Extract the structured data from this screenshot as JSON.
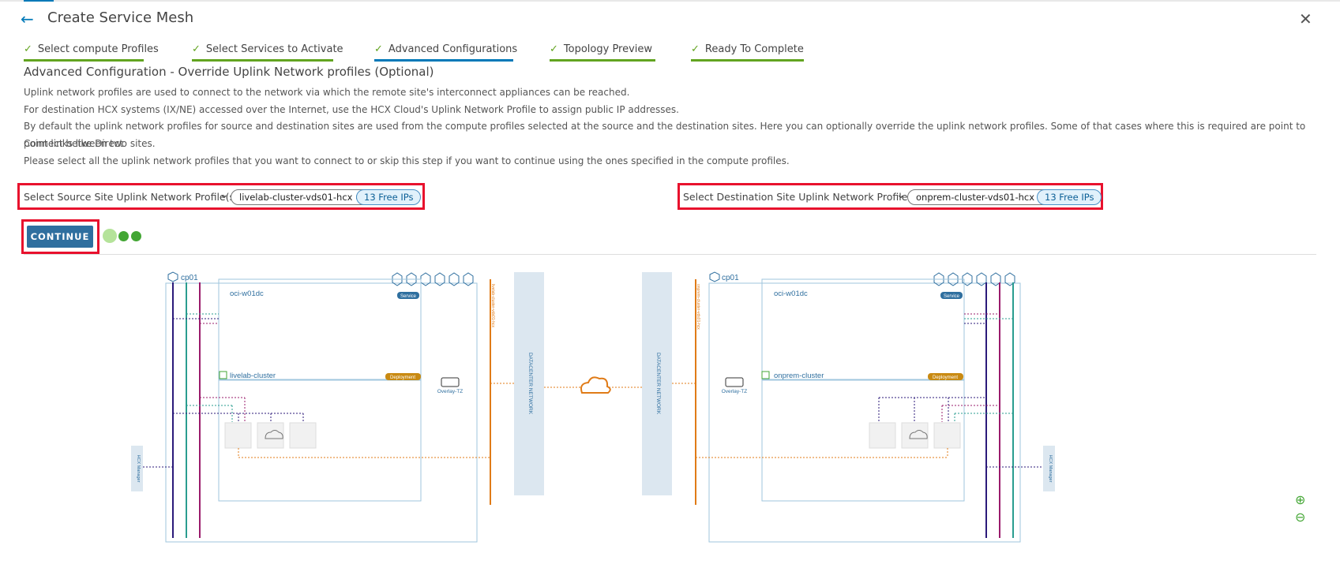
{
  "header": {
    "title": "Create Service Mesh",
    "back_icon": "arrow-left-icon",
    "close_icon": "close-icon"
  },
  "steps": [
    {
      "label": "Select compute Profiles",
      "state": "done"
    },
    {
      "label": "Select Services to Activate",
      "state": "done"
    },
    {
      "label": "Advanced Configurations",
      "state": "current"
    },
    {
      "label": "Topology Preview",
      "state": "done"
    },
    {
      "label": "Ready To Complete",
      "state": "done"
    }
  ],
  "section": {
    "title": "Advanced Configuration - Override Uplink Network profiles (Optional)",
    "desc1": "Uplink network profiles are used to connect to the network via which the remote site's interconnect appliances can be reached.",
    "desc2": "For destination HCX systems (IX/NE) accessed over the Internet, use the HCX Cloud's Uplink Network Profile to assign public IP addresses.",
    "desc3": "By default the uplink network profiles for source and destination sites are used from the compute profiles selected at the source and the destination sites. Here you can optionally override the uplink network profiles. Some of that cases where this is required are point to point links like Direct",
    "desc3b": "Connect between two sites.",
    "desc4": "Please select all the uplink network profiles that you want to connect to or skip this step if you want to continue using the ones specified in the compute profiles."
  },
  "source": {
    "label": "Select Source Site Uplink Network Profile(s)",
    "profile": "livelab-cluster-vds01-hcx",
    "free_ips": "13 Free IPs"
  },
  "destination": {
    "label": "Select Destination Site Uplink Network Profile(s)",
    "profile": "onprem-cluster-vds01-hcx",
    "free_ips": "13 Free IPs"
  },
  "actions": {
    "continue_label": "CONTINUE"
  },
  "topology": {
    "left": {
      "cp": "cp01",
      "site": "oci-w01dc",
      "service_badge": "Service",
      "cluster": "livelab-cluster",
      "deploy_badge": "Deployment",
      "overlay": "Overlay-TZ",
      "uplink_net": "livelab-cluster-vds01-hcx",
      "manager": "HCX Manager"
    },
    "right": {
      "cp": "cp01",
      "site": "oci-w01dc",
      "service_badge": "Service",
      "cluster": "onprem-cluster",
      "deploy_badge": "Deployment",
      "overlay": "Overlay-TZ",
      "uplink_net": "onprem-cluster-vds01-hcx",
      "manager": "HCX Manager"
    },
    "datacenter_label": "DATACENTER NETWORK"
  },
  "colors": {
    "accent": "#0079b8",
    "done": "#62a420",
    "highlight": "#e8112d",
    "uplink": "#e07b17"
  },
  "icons": {
    "zoom_in": "zoom-in-icon",
    "zoom_out": "zoom-out-icon"
  }
}
